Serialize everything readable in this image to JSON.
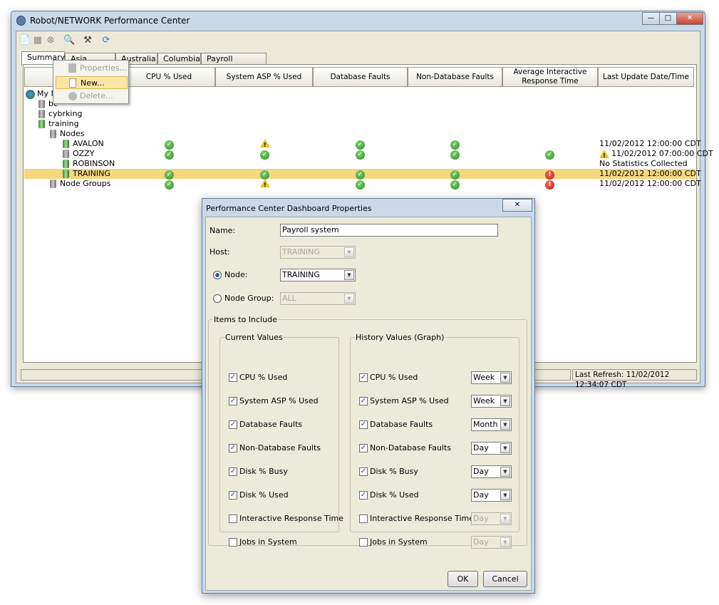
{
  "window": {
    "title": "Robot/NETWORK Performance Center",
    "min": "—",
    "max": "□",
    "close": "✕"
  },
  "toolbar": [
    {
      "icon": "new-icon",
      "glyph": "📄"
    },
    {
      "icon": "properties-icon",
      "glyph": "▦"
    },
    {
      "icon": "delete-icon",
      "glyph": "⊗"
    },
    {
      "icon": "preview-icon",
      "glyph": "🔍"
    },
    {
      "icon": "tools-icon",
      "glyph": "⚒"
    },
    {
      "icon": "refresh-icon",
      "glyph": "⟳"
    }
  ],
  "tabs": [
    "Summary",
    "Asia Pacific",
    "Australia",
    "Columbia",
    "Payroll system"
  ],
  "context_menu": [
    {
      "label": "Properties...",
      "enabled": false
    },
    {
      "label": "New...",
      "enabled": true
    },
    {
      "label": "Delete...",
      "enabled": false
    }
  ],
  "columns": [
    "",
    "CPU % Used",
    "System ASP % Used",
    "Database Faults",
    "Non-Database Faults",
    "Average Interactive Response Time",
    "Last Update Date/Time"
  ],
  "tree": [
    {
      "label": "My N",
      "depth": 0,
      "icon": "globe-icon"
    },
    {
      "label": "bc",
      "depth": 1,
      "icon": "server-icon"
    },
    {
      "label": "cybrking",
      "depth": 1,
      "icon": "server-icon"
    },
    {
      "label": "training",
      "depth": 1,
      "icon": "server-green-icon"
    },
    {
      "label": "Nodes",
      "depth": 2,
      "icon": "nodes-icon"
    },
    {
      "label": "AVALON",
      "depth": 3,
      "icon": "server-green-icon",
      "status": [
        "ok",
        "warn",
        "ok",
        "ok",
        ""
      ],
      "last": "11/02/2012 12:00:00 CDT"
    },
    {
      "label": "OZZY",
      "depth": 3,
      "icon": "server-icon",
      "status": [
        "ok",
        "ok",
        "ok",
        "ok",
        "ok"
      ],
      "last": "11/02/2012 07:00:00 CDT",
      "last_warn": true
    },
    {
      "label": "ROBINSON",
      "depth": 3,
      "icon": "server-green-icon",
      "status": [
        "",
        "",
        "",
        "",
        ""
      ],
      "last": "No Statistics Collected"
    },
    {
      "label": "TRAINING",
      "depth": 3,
      "icon": "server-green-icon",
      "status": [
        "ok",
        "ok",
        "ok",
        "ok",
        "err"
      ],
      "last": "11/02/2012 12:00:00 CDT",
      "selected": true
    },
    {
      "label": "Node Groups",
      "depth": 2,
      "icon": "node-groups-icon",
      "status": [
        "ok",
        "warn",
        "ok",
        "ok",
        "err"
      ],
      "last": "11/02/2012 12:00:00 CDT"
    }
  ],
  "status_bar": {
    "left": "",
    "last_refresh": "Last Refresh: 11/02/2012 12:34:07 CDT"
  },
  "dialog": {
    "title": "Performance Center Dashboard Properties",
    "close": "✕",
    "name_label": "Name:",
    "name_value": "Payroll system",
    "host_label": "Host:",
    "host_value": "TRAINING",
    "node_label": "Node:",
    "node_value": "TRAINING",
    "node_selected": true,
    "node_group_label": "Node Group:",
    "node_group_value": "ALL",
    "items_legend": "Items to Include",
    "current_legend": "Current Values",
    "history_legend": "History Values (Graph)",
    "current": [
      {
        "label": "CPU % Used",
        "checked": true
      },
      {
        "label": "System ASP % Used",
        "checked": true
      },
      {
        "label": "Database Faults",
        "checked": true
      },
      {
        "label": "Non-Database Faults",
        "checked": true
      },
      {
        "label": "Disk % Busy",
        "checked": true
      },
      {
        "label": "Disk % Used",
        "checked": true
      },
      {
        "label": "Interactive Response Time",
        "checked": false
      },
      {
        "label": "Jobs in System",
        "checked": false
      }
    ],
    "history": [
      {
        "label": "CPU % Used",
        "checked": true,
        "period": "Week"
      },
      {
        "label": "System ASP % Used",
        "checked": true,
        "period": "Week"
      },
      {
        "label": "Database Faults",
        "checked": true,
        "period": "Month"
      },
      {
        "label": "Non-Database Faults",
        "checked": true,
        "period": "Day"
      },
      {
        "label": "Disk % Busy",
        "checked": true,
        "period": "Day"
      },
      {
        "label": "Disk % Used",
        "checked": true,
        "period": "Day"
      },
      {
        "label": "Interactive Response Time",
        "checked": false,
        "period": "Day"
      },
      {
        "label": "Jobs in System",
        "checked": false,
        "period": "Day"
      }
    ],
    "ok": "OK",
    "cancel": "Cancel"
  }
}
